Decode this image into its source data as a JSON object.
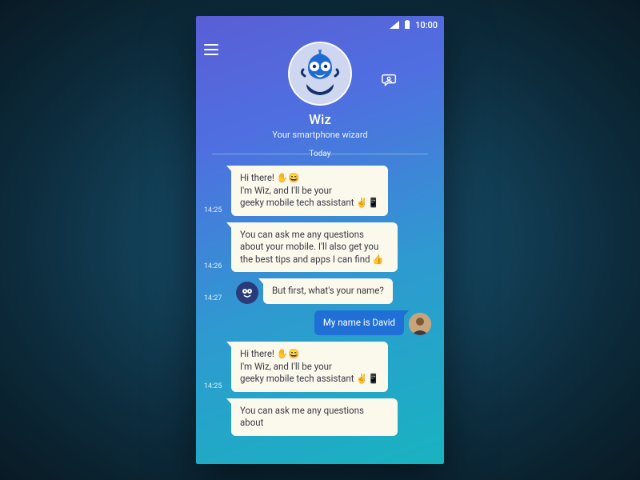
{
  "statusbar": {
    "time": "10:00"
  },
  "header": {
    "name": "Wiz",
    "subtitle": "Your smartphone wizard"
  },
  "divider": {
    "label": "Today"
  },
  "messages": [
    {
      "dir": "in",
      "time": "14:25",
      "text": "Hi there! ✋😄\nI'm Wiz, and I'll be your\ngeeky mobile tech assistant ✌️📱"
    },
    {
      "dir": "in",
      "time": "14:26",
      "text": "You can ask me any questions about your mobile. I'll also get you the best tips and apps I can find 👍"
    },
    {
      "dir": "in",
      "time": "14:27",
      "text": "But first, what's your name?",
      "showBotAvatar": true
    },
    {
      "dir": "out",
      "text": "My name is David",
      "showUserAvatar": true
    },
    {
      "dir": "in",
      "time": "14:25",
      "text": "Hi there! ✋😄\nI'm Wiz, and I'll be your\ngeeky mobile tech assistant ✌️📱"
    },
    {
      "dir": "in",
      "text": "You can ask me any questions about"
    }
  ]
}
